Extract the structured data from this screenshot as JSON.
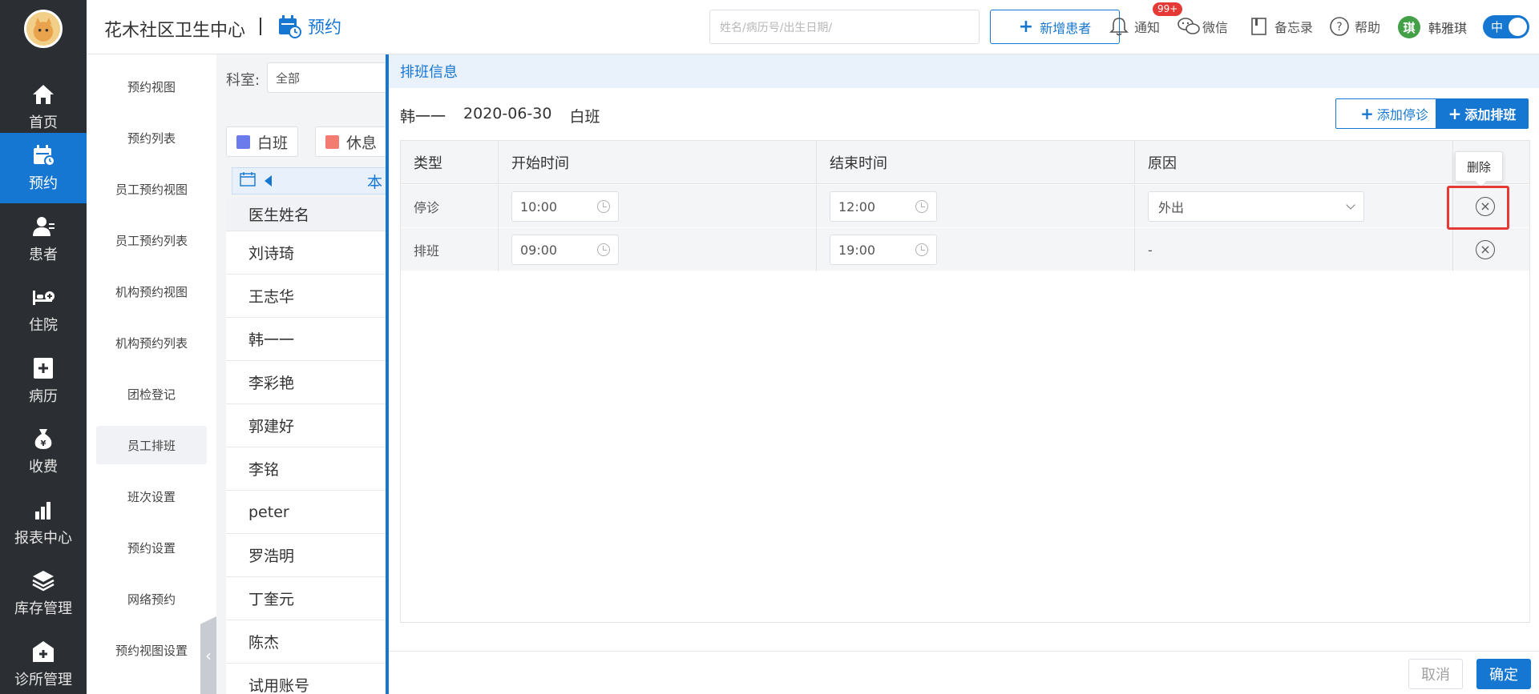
{
  "left_nav": {
    "items": [
      {
        "label": "首页",
        "icon": "home-icon"
      },
      {
        "label": "预约",
        "icon": "calendar-icon"
      },
      {
        "label": "患者",
        "icon": "patient-icon"
      },
      {
        "label": "住院",
        "icon": "bed-icon"
      },
      {
        "label": "病历",
        "icon": "medical-record-icon"
      },
      {
        "label": "收费",
        "icon": "money-bag-icon"
      },
      {
        "label": "报表中心",
        "icon": "bar-chart-icon"
      },
      {
        "label": "库存管理",
        "icon": "layers-icon"
      },
      {
        "label": "诊所管理",
        "icon": "clinic-icon"
      }
    ]
  },
  "header": {
    "org": "花木社区卫生中心",
    "section": "预约",
    "search_placeholder": "姓名/病历号/出生日期/",
    "add_patient": "新增患者",
    "notify_label": "通知",
    "notify_badge": "99+",
    "wechat_label": "微信",
    "memo_label": "备忘录",
    "help_label": "帮助",
    "user_initial": "琪",
    "user_name": "韩雅琪",
    "lang_toggle": "中"
  },
  "sub_nav": {
    "items": [
      "预约视图",
      "预约列表",
      "员工预约视图",
      "员工预约列表",
      "机构预约视图",
      "机构预约列表",
      "团检登记",
      "员工排班",
      "班次设置",
      "预约设置",
      "网络预约",
      "预约视图设置"
    ]
  },
  "middle": {
    "dept_label": "科室:",
    "dept_value": "全部",
    "legend": [
      {
        "label": "白班",
        "color": "#6b7bec"
      },
      {
        "label": "休息",
        "color": "#f47b72"
      }
    ],
    "week_label": "本",
    "doctor_header": "医生姓名",
    "doctors": [
      "刘诗琦",
      "王志华",
      "韩一一",
      "李彩艳",
      "郭建好",
      "李铭",
      "peter",
      "罗浩明",
      "丁奎元",
      "陈杰",
      "试用账号"
    ]
  },
  "panel": {
    "title": "排班信息",
    "staff": "韩一一",
    "date": "2020-06-30",
    "shift": "白班",
    "add_stop": "添加停诊",
    "add_shift": "添加排班",
    "columns": [
      "类型",
      "开始时间",
      "结束时间",
      "原因"
    ],
    "rows": [
      {
        "type": "停诊",
        "start": "10:00",
        "end": "12:00",
        "reason": "外出"
      },
      {
        "type": "排班",
        "start": "09:00",
        "end": "19:00",
        "reason": "-"
      }
    ],
    "delete_tooltip": "删除",
    "cancel": "取消",
    "confirm": "确定"
  }
}
